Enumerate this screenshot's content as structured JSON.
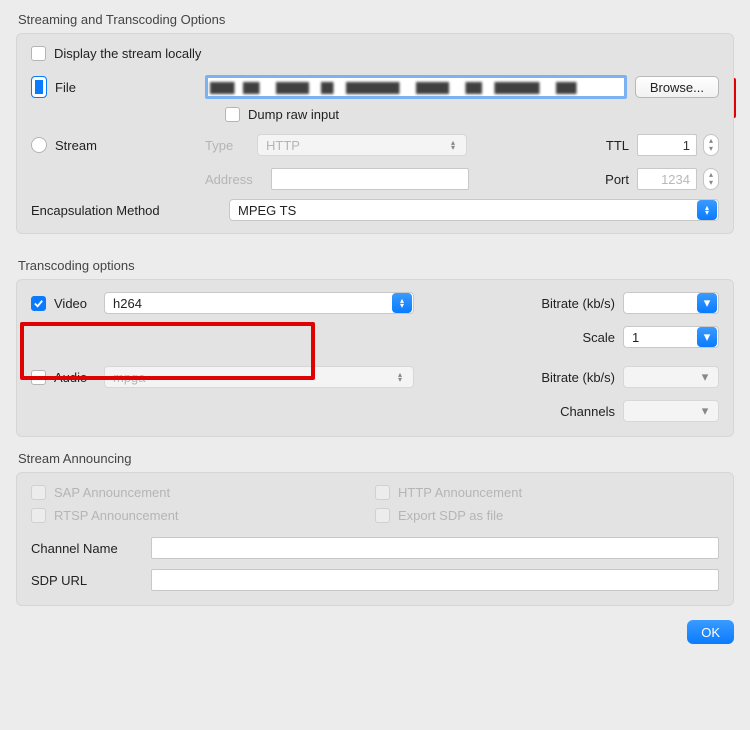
{
  "section1": {
    "title": "Streaming and Transcoding Options",
    "display_locally": "Display the stream locally",
    "file": "File",
    "browse": "Browse...",
    "dump_raw": "Dump raw input",
    "stream": "Stream",
    "type": "Type",
    "type_value": "HTTP",
    "ttl": "TTL",
    "ttl_value": "1",
    "address": "Address",
    "port": "Port",
    "port_placeholder": "1234",
    "encap": "Encapsulation Method",
    "encap_value": "MPEG TS"
  },
  "section2": {
    "title": "Transcoding options",
    "video": "Video",
    "video_codec": "h264",
    "bitrate": "Bitrate (kb/s)",
    "scale": "Scale",
    "scale_value": "1",
    "audio": "Audio",
    "audio_codec": "mpga",
    "channels": "Channels"
  },
  "section3": {
    "title": "Stream Announcing",
    "sap": "SAP Announcement",
    "http": "HTTP Announcement",
    "rtsp": "RTSP Announcement",
    "sdp": "Export SDP as file",
    "chan": "Channel Name",
    "sdpurl": "SDP URL"
  },
  "ok": "OK"
}
